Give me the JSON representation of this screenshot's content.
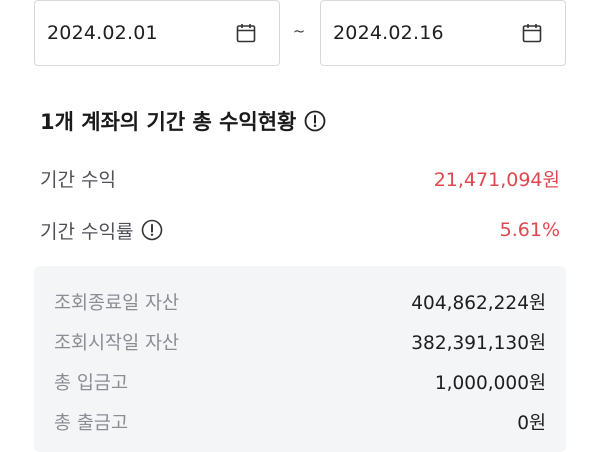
{
  "date_range": {
    "start": "2024.02.01",
    "separator": "~",
    "end": "2024.02.16"
  },
  "summary": {
    "title": "1개 계좌의 기간 총 수익현황",
    "period_profit": {
      "label": "기간 수익",
      "value": "21,471,094원"
    },
    "period_return": {
      "label": "기간 수익률",
      "value": "5.61%"
    }
  },
  "details": [
    {
      "label": "조회종료일 자산",
      "value": "404,862,224원"
    },
    {
      "label": "조회시작일 자산",
      "value": "382,391,130원"
    },
    {
      "label": "총 입금고",
      "value": "1,000,000원"
    },
    {
      "label": "총 출금고",
      "value": "0원"
    }
  ],
  "colors": {
    "positive": "#e0484f",
    "label": "#4f5157",
    "muted_label": "#8a8d94",
    "panel_bg": "#f4f5f7",
    "border": "#d7d9dd"
  },
  "icons": {
    "calendar": "calendar-icon",
    "info": "info-circle-icon"
  }
}
